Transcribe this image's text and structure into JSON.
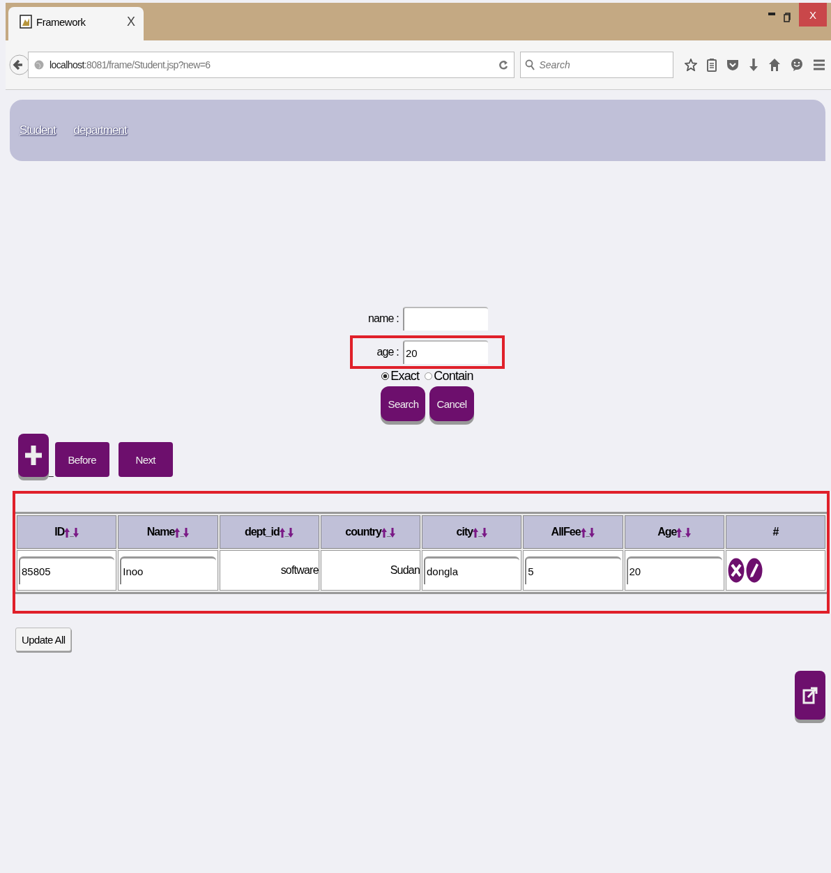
{
  "browser": {
    "tab_title": "Framework",
    "tab_close": "X",
    "window_close": "X",
    "url_host": "localhost",
    "url_path": ":8081/frame/Student.jsp?new=6",
    "search_placeholder": "Search"
  },
  "nav": {
    "links": [
      "Student",
      "department"
    ]
  },
  "search_form": {
    "fields": [
      {
        "label": "name :",
        "highlighted": false
      },
      {
        "label": "age :",
        "value": "20",
        "highlighted": true
      }
    ],
    "match_options": [
      {
        "label": "Exact",
        "selected": true
      },
      {
        "label": "Contain",
        "selected": false
      }
    ],
    "buttons": [
      "Search",
      "Cancel"
    ]
  },
  "pager": {
    "add_suffix": "_",
    "buttons": [
      "Before",
      "Next"
    ]
  },
  "table": {
    "highlighted": true,
    "columns": [
      {
        "label": "ID",
        "sortable": true,
        "separator": "_"
      },
      {
        "label": "Name",
        "sortable": true,
        "separator": "_"
      },
      {
        "label": "dept_id",
        "sortable": true,
        "separator": "_"
      },
      {
        "label": "country",
        "sortable": true,
        "separator": "_"
      },
      {
        "label": "city",
        "sortable": true,
        "separator": "_"
      },
      {
        "label": "AllFee",
        "sortable": true,
        "separator": "_"
      },
      {
        "label": "Age",
        "sortable": true,
        "separator": "_"
      },
      {
        "label": "#",
        "sortable": false
      }
    ],
    "rows": [
      {
        "cells": [
          {
            "kind": "input",
            "value": "85805"
          },
          {
            "kind": "input",
            "value": "Inoo"
          },
          {
            "kind": "text",
            "value": "software"
          },
          {
            "kind": "text",
            "value": "Sudan"
          },
          {
            "kind": "input",
            "value": "dongla"
          },
          {
            "kind": "input",
            "value": "5"
          },
          {
            "kind": "input",
            "value": "20"
          },
          {
            "kind": "actions"
          }
        ]
      }
    ]
  },
  "update_button": "Update All"
}
